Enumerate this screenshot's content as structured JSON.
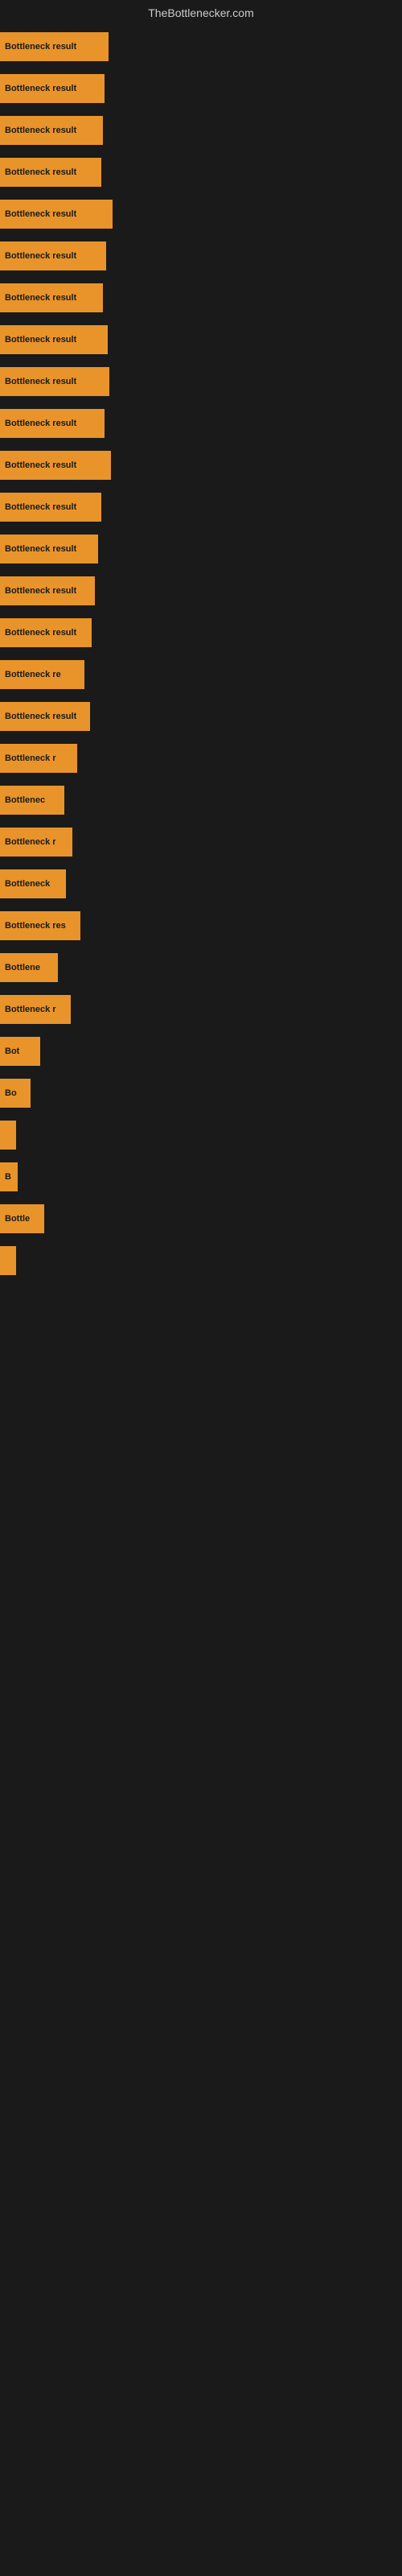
{
  "site": {
    "title": "TheBottlenecker.com"
  },
  "bars": [
    {
      "label": "Bottleneck result",
      "width": 135,
      "id": 1
    },
    {
      "label": "Bottleneck result",
      "width": 130,
      "id": 2
    },
    {
      "label": "Bottleneck result",
      "width": 128,
      "id": 3
    },
    {
      "label": "Bottleneck result",
      "width": 126,
      "id": 4
    },
    {
      "label": "Bottleneck result",
      "width": 140,
      "id": 5
    },
    {
      "label": "Bottleneck result",
      "width": 132,
      "id": 6
    },
    {
      "label": "Bottleneck result",
      "width": 128,
      "id": 7
    },
    {
      "label": "Bottleneck result",
      "width": 134,
      "id": 8
    },
    {
      "label": "Bottleneck result",
      "width": 136,
      "id": 9
    },
    {
      "label": "Bottleneck result",
      "width": 130,
      "id": 10
    },
    {
      "label": "Bottleneck result",
      "width": 138,
      "id": 11
    },
    {
      "label": "Bottleneck result",
      "width": 126,
      "id": 12
    },
    {
      "label": "Bottleneck result",
      "width": 122,
      "id": 13
    },
    {
      "label": "Bottleneck result",
      "width": 118,
      "id": 14
    },
    {
      "label": "Bottleneck result",
      "width": 114,
      "id": 15
    },
    {
      "label": "Bottleneck re",
      "width": 105,
      "id": 16
    },
    {
      "label": "Bottleneck result",
      "width": 112,
      "id": 17
    },
    {
      "label": "Bottleneck r",
      "width": 96,
      "id": 18
    },
    {
      "label": "Bottlenec",
      "width": 80,
      "id": 19
    },
    {
      "label": "Bottleneck r",
      "width": 90,
      "id": 20
    },
    {
      "label": "Bottleneck",
      "width": 82,
      "id": 21
    },
    {
      "label": "Bottleneck res",
      "width": 100,
      "id": 22
    },
    {
      "label": "Bottlene",
      "width": 72,
      "id": 23
    },
    {
      "label": "Bottleneck r",
      "width": 88,
      "id": 24
    },
    {
      "label": "Bot",
      "width": 50,
      "id": 25
    },
    {
      "label": "Bo",
      "width": 38,
      "id": 26
    },
    {
      "label": "",
      "width": 8,
      "id": 27
    },
    {
      "label": "B",
      "width": 22,
      "id": 28
    },
    {
      "label": "Bottle",
      "width": 55,
      "id": 29
    },
    {
      "label": "",
      "width": 6,
      "id": 30
    },
    {
      "label": "",
      "width": 0,
      "id": 31
    },
    {
      "label": "",
      "width": 0,
      "id": 32
    },
    {
      "label": "",
      "width": 0,
      "id": 33
    },
    {
      "label": "",
      "width": 0,
      "id": 34
    },
    {
      "label": "",
      "width": 0,
      "id": 35
    },
    {
      "label": "",
      "width": 0,
      "id": 36
    },
    {
      "label": "",
      "width": 0,
      "id": 37
    },
    {
      "label": "",
      "width": 0,
      "id": 38
    }
  ]
}
